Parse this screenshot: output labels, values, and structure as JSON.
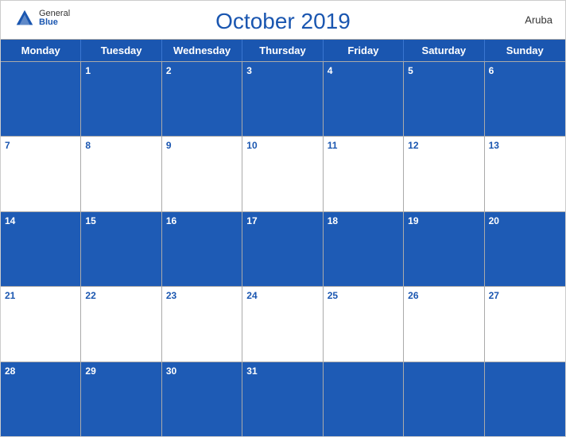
{
  "header": {
    "title": "October 2019",
    "country": "Aruba",
    "logo": {
      "general": "General",
      "blue": "Blue"
    }
  },
  "days_of_week": [
    "Monday",
    "Tuesday",
    "Wednesday",
    "Thursday",
    "Friday",
    "Saturday",
    "Sunday"
  ],
  "weeks": [
    [
      null,
      1,
      2,
      3,
      4,
      5,
      6
    ],
    [
      7,
      8,
      9,
      10,
      11,
      12,
      13
    ],
    [
      14,
      15,
      16,
      17,
      18,
      19,
      20
    ],
    [
      21,
      22,
      23,
      24,
      25,
      26,
      27
    ],
    [
      28,
      29,
      30,
      31,
      null,
      null,
      null
    ]
  ],
  "colors": {
    "blue": "#1a56b0",
    "header_bg": "#1e5bb5",
    "white": "#ffffff"
  }
}
